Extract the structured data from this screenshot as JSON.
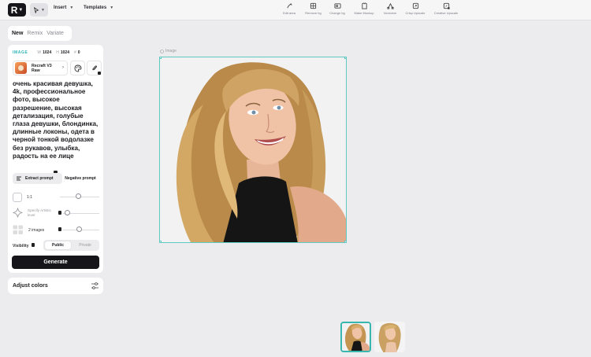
{
  "topbar": {
    "menus": [
      {
        "label": "Insert"
      },
      {
        "label": "Templates"
      }
    ],
    "tools": [
      {
        "label": "Edit area",
        "icon": "brush-icon"
      },
      {
        "label": "Remove bg",
        "icon": "remove-bg-icon"
      },
      {
        "label": "Change bg",
        "icon": "change-bg-icon"
      },
      {
        "label": "Make Mockup",
        "icon": "mockup-icon"
      },
      {
        "label": "Vectorize",
        "icon": "vectorize-icon"
      },
      {
        "label": "Crisp Upscale",
        "icon": "crisp-upscale-icon"
      },
      {
        "label": "Creative Upscale",
        "icon": "creative-upscale-icon"
      }
    ]
  },
  "tabs": [
    "New",
    "Remix",
    "Variate"
  ],
  "panel": {
    "type_label": "IMAGE",
    "width_label": "W",
    "width_value": "1024",
    "height_label": "H",
    "height_value": "1024",
    "count_label": "#",
    "count_value": "0",
    "model_name": "Recraft V3 Raw",
    "prompt": "очень красивая девушка, 4k, профессиональное фото, высокое разрешение, высокая детализация, голубые глаза девушки, блондинка, длинные локоны, одета в черной тонкой водолазке без рукавов, улыбка, радость на ее лице",
    "extract_prompt": "Extract prompt",
    "negative_prompt": "Negative prompt",
    "aspect_ratio": "1:1",
    "artistic_label": "Specify Artistic level",
    "images_count": "2 images",
    "visibility_label": "Visibility",
    "visibility_public": "Public",
    "visibility_private": "Private",
    "generate": "Generate"
  },
  "adjust_colors": "Adjust colors",
  "canvas": {
    "frame_label": "Image"
  },
  "colors": {
    "accent": "#2bb3b3",
    "selection": "#5ec8c2",
    "primary_button": "#16161a"
  }
}
